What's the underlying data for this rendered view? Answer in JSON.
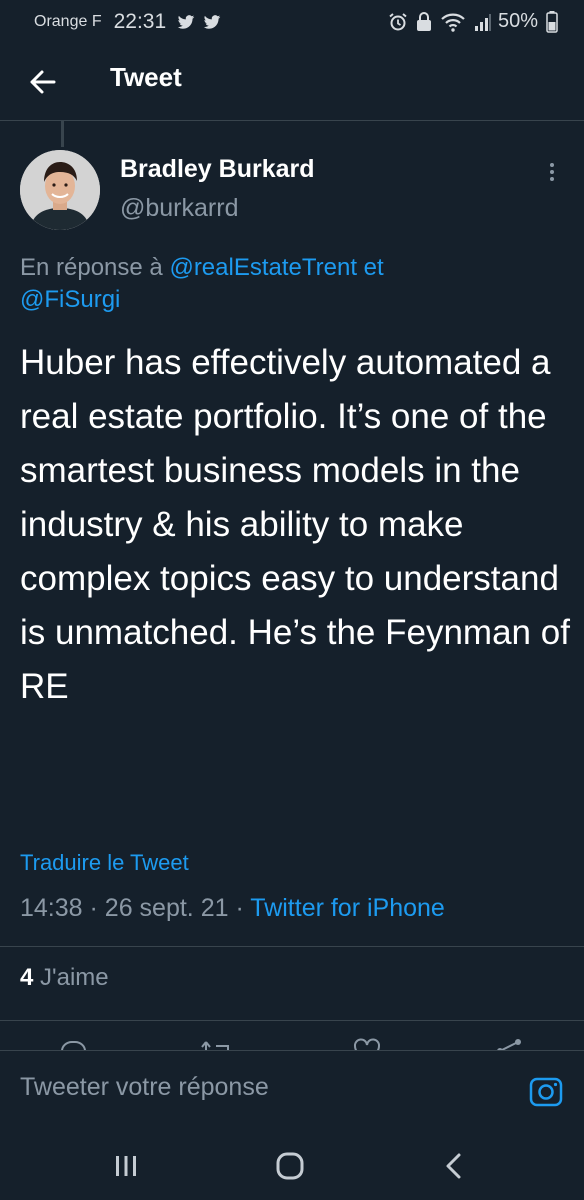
{
  "status_bar": {
    "carrier": "Orange F",
    "time": "22:31",
    "battery": "50%"
  },
  "header": {
    "title": "Tweet"
  },
  "tweet": {
    "author_name": "Bradley Burkard",
    "author_handle": "@burkarrd",
    "reply_prefix": "En réponse à",
    "reply_mention_1": "@realEstateTrent",
    "reply_conjunction": "et",
    "reply_mention_2": "@FiSurgi",
    "text": "Huber has effectively automated a real estate portfolio. It’s one of the smartest business models in the industry & his ability to make complex topics easy to understand is unmatched. He’s the Feynman of RE",
    "translate_label": "Traduire le Tweet",
    "time": "14:38",
    "separator": "·",
    "date": "26 sept. 21",
    "source": "Twitter for iPhone",
    "likes_count": "4",
    "likes_label": "J'aime"
  },
  "reply_bar": {
    "placeholder": "Tweeter votre réponse"
  },
  "colors": {
    "background": "#15202b",
    "accent": "#1d9bf0",
    "secondary_text": "#8b98a5",
    "divider": "#38444d"
  },
  "icons": {
    "back": "arrow-left-icon",
    "more": "more-vertical-icon",
    "camera": "camera-icon",
    "recents": "recent-apps-icon",
    "home": "home-icon",
    "nav_back": "chevron-left-icon"
  }
}
